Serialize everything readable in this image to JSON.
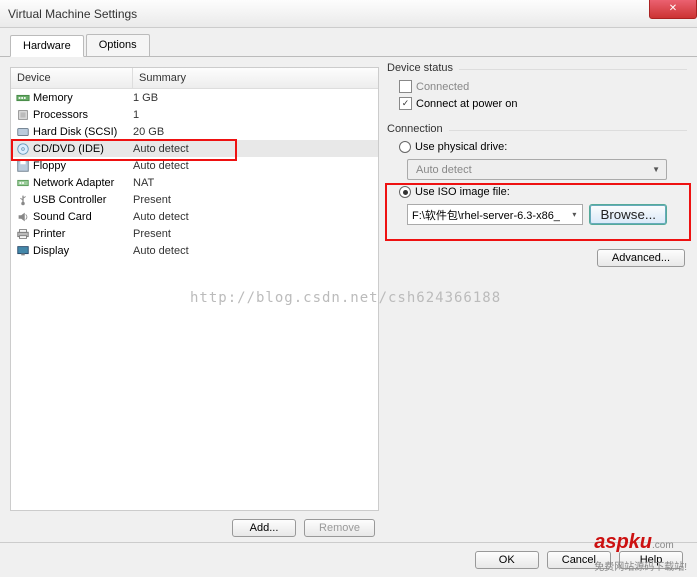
{
  "window": {
    "title": "Virtual Machine Settings"
  },
  "tabs": {
    "hardware": "Hardware",
    "options": "Options"
  },
  "table": {
    "headers": {
      "device": "Device",
      "summary": "Summary"
    },
    "rows": [
      {
        "name": "Memory",
        "summary": "1 GB"
      },
      {
        "name": "Processors",
        "summary": "1"
      },
      {
        "name": "Hard Disk (SCSI)",
        "summary": "20 GB"
      },
      {
        "name": "CD/DVD (IDE)",
        "summary": "Auto detect"
      },
      {
        "name": "Floppy",
        "summary": "Auto detect"
      },
      {
        "name": "Network Adapter",
        "summary": "NAT"
      },
      {
        "name": "USB Controller",
        "summary": "Present"
      },
      {
        "name": "Sound Card",
        "summary": "Auto detect"
      },
      {
        "name": "Printer",
        "summary": "Present"
      },
      {
        "name": "Display",
        "summary": "Auto detect"
      }
    ]
  },
  "buttons": {
    "add": "Add...",
    "remove": "Remove",
    "ok": "OK",
    "cancel": "Cancel",
    "help": "Help",
    "advanced": "Advanced...",
    "browse": "Browse..."
  },
  "status": {
    "title": "Device status",
    "connected": "Connected",
    "connect_power": "Connect at power on"
  },
  "connection": {
    "title": "Connection",
    "physical": "Use physical drive:",
    "physical_value": "Auto detect",
    "iso": "Use ISO image file:",
    "iso_value": "F:\\软件包\\rhel-server-6.3-x86_"
  },
  "watermark": "http://blog.csdn.net/csh624366188",
  "logo": {
    "main": "aspku",
    "sub": ".com",
    "tag": "免费网站源码下载站!"
  }
}
